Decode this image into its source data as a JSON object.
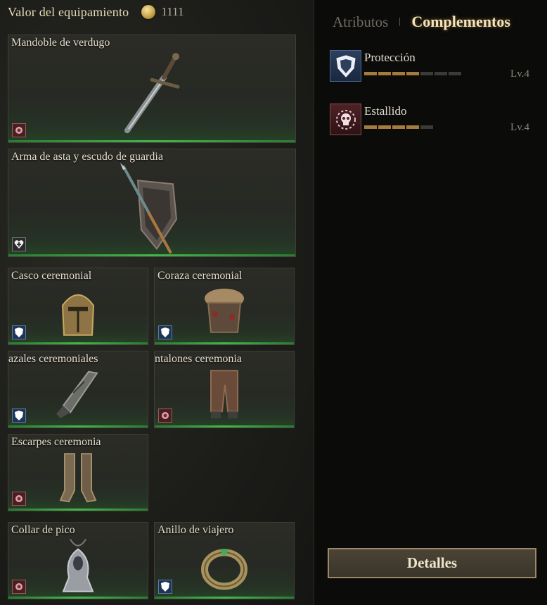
{
  "header": {
    "title": "Valor del equipamiento",
    "value": "1111"
  },
  "slots": [
    {
      "name": "Mandoble de verdugo",
      "badge": "rose-icon"
    },
    {
      "name": "Arma de asta y escudo de guardia",
      "badge": "heart-cross-icon"
    },
    {
      "name": "Casco ceremonial",
      "badge": "shield-icon"
    },
    {
      "name": "Coraza ceremonial",
      "badge": "shield-icon"
    },
    {
      "name": "azales ceremoniales",
      "badge": "shield-icon"
    },
    {
      "name": "ntalones ceremonia",
      "badge": "rose-icon"
    },
    {
      "name": "Escarpes ceremonia",
      "badge": "rose-icon"
    },
    {
      "name": "Collar de pico",
      "badge": "rose-icon"
    },
    {
      "name": "Anillo de viajero",
      "badge": "shield-icon"
    }
  ],
  "tabs": {
    "attributes": "Atributos",
    "addons": "Complementos",
    "active": "addons"
  },
  "addons": [
    {
      "name": "Protección",
      "level": "Lv.4",
      "segments_filled": 4,
      "segments_total": 7,
      "icon": "shield-icon"
    },
    {
      "name": "Estallido",
      "level": "Lv.4",
      "segments_filled": 4,
      "segments_total": 5,
      "icon": "skull-burst-icon"
    }
  ],
  "buttons": {
    "details": "Detalles"
  },
  "colors": {
    "accent_green": "#46b34c",
    "bar_fill": "#a47a3e",
    "tab_active": "#f2e4c0"
  }
}
